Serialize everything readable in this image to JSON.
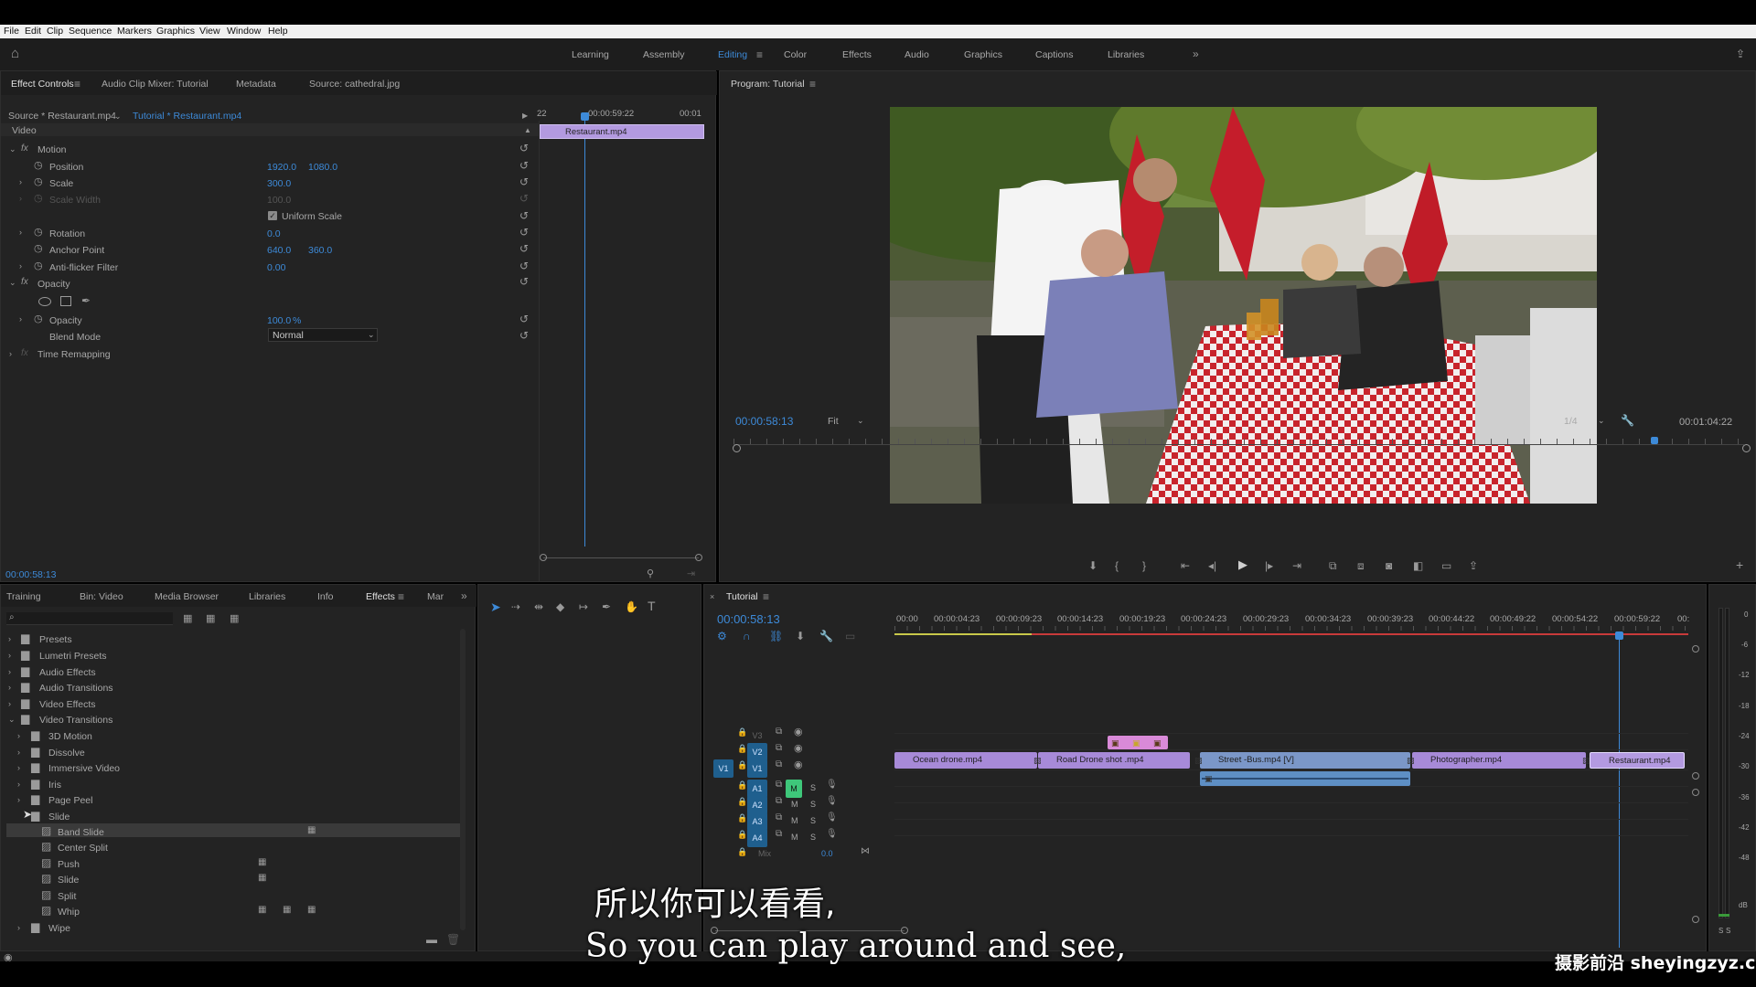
{
  "menu": [
    "File",
    "Edit",
    "Clip",
    "Sequence",
    "Markers",
    "Graphics",
    "View",
    "Window",
    "Help"
  ],
  "workspaces": [
    "Learning",
    "Assembly",
    "Editing",
    "Color",
    "Effects",
    "Audio",
    "Graphics",
    "Captions",
    "Libraries"
  ],
  "ec": {
    "tabs": [
      "Effect Controls",
      "Audio Clip Mixer: Tutorial",
      "Metadata",
      "Source: cathedral.jpg"
    ],
    "source": "Source * Restaurant.mp4",
    "seq": "Tutorial * Restaurant.mp4",
    "tc_a": "22",
    "tc_b": "00:00:59:22",
    "tc_c": "00:01",
    "clip": "Restaurant.mp4",
    "video": "Video",
    "motion": "Motion",
    "position": "Position",
    "pos_x": "1920.0",
    "pos_y": "1080.0",
    "scale": "Scale",
    "scale_v": "300.0",
    "scale_w": "Scale Width",
    "scale_w_v": "100.0",
    "uniform": "Uniform Scale",
    "rotation": "Rotation",
    "rotation_v": "0.0",
    "anchor": "Anchor Point",
    "anchor_x": "640.0",
    "anchor_y": "360.0",
    "antiflicker": "Anti-flicker Filter",
    "antiflicker_v": "0.00",
    "opacity": "Opacity",
    "opacity_v": "100.0",
    "opacity_u": "%",
    "blend": "Blend Mode",
    "blend_v": "Normal",
    "time": "Time Remapping",
    "tc": "00:00:58:13"
  },
  "program": {
    "title": "Program: Tutorial",
    "tc": "00:00:58:13",
    "fit": "Fit",
    "res": "1/4",
    "dur": "00:01:04:22"
  },
  "proj": {
    "tabs": [
      "Training",
      "Bin: Video",
      "Media Browser",
      "Libraries",
      "Info",
      "Effects",
      "Mar"
    ],
    "items": [
      "Presets",
      "Lumetri Presets",
      "Audio Effects",
      "Audio Transitions",
      "Video Effects",
      "Video Transitions"
    ],
    "sub": [
      "3D Motion",
      "Dissolve",
      "Immersive Video",
      "Iris",
      "Page Peel",
      "Slide"
    ],
    "slide": [
      "Band Slide",
      "Center Split",
      "Push",
      "Slide",
      "Split",
      "Whip"
    ],
    "wipe": "Wipe"
  },
  "timeline": {
    "title": "Tutorial",
    "tc": "00:00:58:13",
    "ruler": [
      "00:00",
      "00:00:04:23",
      "00:00:09:23",
      "00:00:14:23",
      "00:00:19:23",
      "00:00:24:23",
      "00:00:29:23",
      "00:00:34:23",
      "00:00:39:23",
      "00:00:44:22",
      "00:00:49:22",
      "00:00:54:22",
      "00:00:59:22",
      "00:"
    ],
    "tracks": [
      "V3",
      "V2",
      "V1",
      "A1",
      "A2",
      "A3",
      "A4"
    ],
    "src_v1": "V1",
    "m": "M",
    "s": "S",
    "mix": "Mix",
    "mix_v": "0.0",
    "clips": [
      "Ocean drone.mp4",
      "Road Drone shot .mp4",
      "Street -Bus.mp4 [V]",
      "Photographer.mp4",
      "Restaurant.mp4"
    ],
    "meter": [
      "0",
      "-6",
      "-12",
      "-18",
      "-24",
      "-30",
      "-36",
      "-42",
      "-48",
      "dB"
    ]
  },
  "subtitle": {
    "zh": "所以你可以看看,",
    "en": "So you can play around and see,"
  },
  "watermark": "摄影前沿 sheyingzyz.com",
  "colors": {
    "accent": "#3d8ad8",
    "clip_purple": "#a78ad8",
    "clip_blue": "#7b97c8",
    "panel": "#232323"
  }
}
